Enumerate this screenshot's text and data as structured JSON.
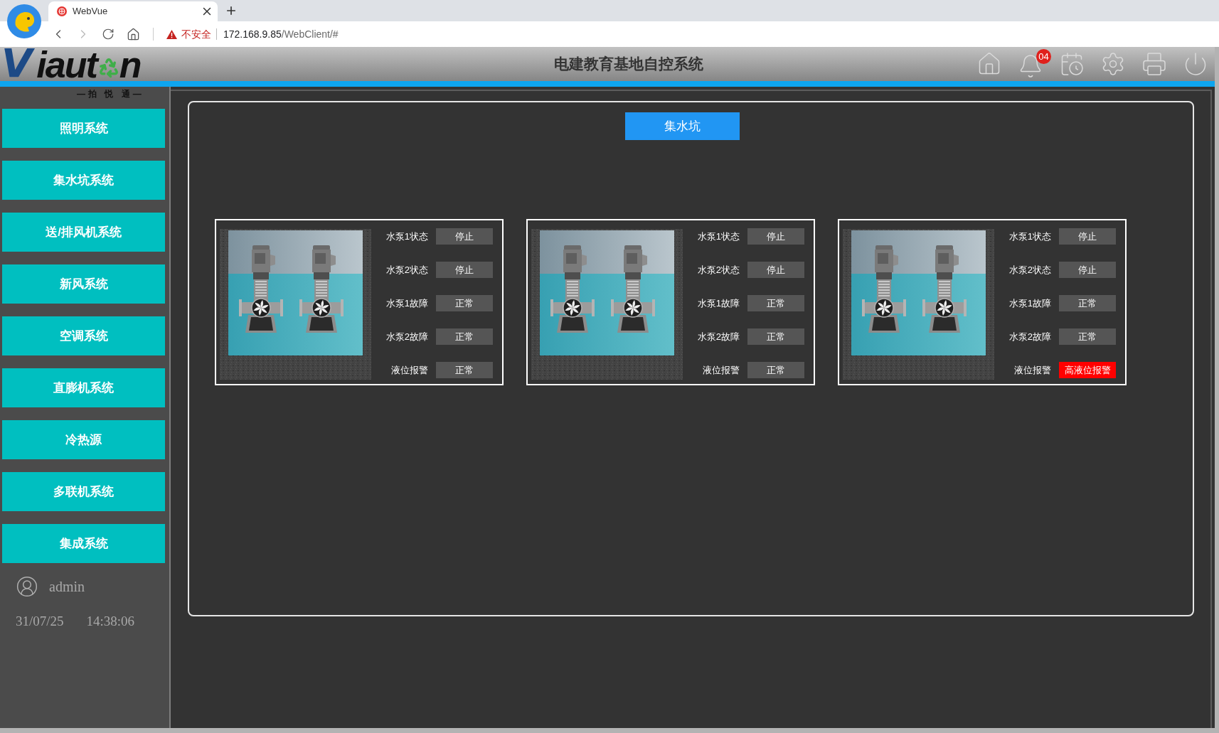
{
  "browser": {
    "tab": {
      "title": "WebVue"
    },
    "nav": {
      "back_disabled": false,
      "forward_disabled": true
    },
    "security_label": "不安全",
    "url_host": "172.168.9.85",
    "url_path": "/WebClient/#"
  },
  "header": {
    "logo": {
      "initial": "V",
      "middle": "iaut",
      "last": "n",
      "tagline": "—拍 悦 通—"
    },
    "title": "电建教育基地自控系统",
    "notification_badge": "04"
  },
  "sidebar": {
    "items": [
      {
        "label": "照明系统"
      },
      {
        "label": "集水坑系统"
      },
      {
        "label": "送/排风机系统"
      },
      {
        "label": "新风系统"
      },
      {
        "label": "空调系统"
      },
      {
        "label": "直膨机系统"
      },
      {
        "label": "冷热源"
      },
      {
        "label": "多联机系统"
      },
      {
        "label": "集成系统"
      }
    ],
    "user": "admin",
    "date": "31/07/25",
    "time": "14:38:06"
  },
  "main": {
    "section_button": "集水坑",
    "pits": [
      {
        "rows": [
          {
            "label": "水泵1状态",
            "value": "停止",
            "alarm": false
          },
          {
            "label": "水泵2状态",
            "value": "停止",
            "alarm": false
          },
          {
            "label": "水泵1故障",
            "value": "正常",
            "alarm": false
          },
          {
            "label": "水泵2故障",
            "value": "正常",
            "alarm": false
          },
          {
            "label": "液位报警",
            "value": "正常",
            "alarm": false
          }
        ]
      },
      {
        "rows": [
          {
            "label": "水泵1状态",
            "value": "停止",
            "alarm": false
          },
          {
            "label": "水泵2状态",
            "value": "停止",
            "alarm": false
          },
          {
            "label": "水泵1故障",
            "value": "正常",
            "alarm": false
          },
          {
            "label": "水泵2故障",
            "value": "正常",
            "alarm": false
          },
          {
            "label": "液位报警",
            "value": "正常",
            "alarm": false
          }
        ]
      },
      {
        "rows": [
          {
            "label": "水泵1状态",
            "value": "停止",
            "alarm": false
          },
          {
            "label": "水泵2状态",
            "value": "停止",
            "alarm": false
          },
          {
            "label": "水泵1故障",
            "value": "正常",
            "alarm": false
          },
          {
            "label": "水泵2故障",
            "value": "正常",
            "alarm": false
          },
          {
            "label": "液位报警",
            "value": "高液位报警",
            "alarm": true
          }
        ]
      }
    ]
  }
}
